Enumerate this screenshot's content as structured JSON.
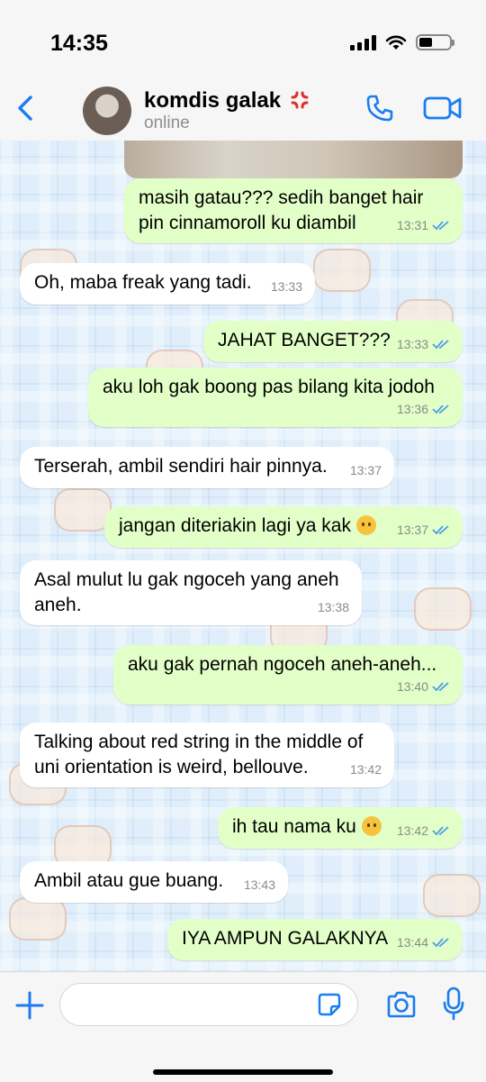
{
  "status_bar": {
    "time": "14:35"
  },
  "header": {
    "contact_name": "komdis galak",
    "contact_status": "online"
  },
  "messages": [
    {
      "direction": "out",
      "text": "masih gatau??? sedih banget hair\npin cinnamoroll ku diambil",
      "time": "13:31",
      "read": true
    },
    {
      "direction": "in",
      "text": "Oh, maba freak yang tadi.",
      "time": "13:33"
    },
    {
      "direction": "out",
      "text": "JAHAT BANGET???",
      "time": "13:33",
      "read": true
    },
    {
      "direction": "out",
      "text": "aku loh gak boong pas bilang kita jodoh",
      "time": "13:36",
      "read": true
    },
    {
      "direction": "in",
      "text": "Terserah, ambil sendiri hair pinnya.",
      "time": "13:37"
    },
    {
      "direction": "out",
      "text": "jangan diteriakin lagi ya kak",
      "emoji": "disappointed-face",
      "time": "13:37",
      "read": true
    },
    {
      "direction": "in",
      "text": "Asal mulut lu gak ngoceh yang aneh\naneh.",
      "time": "13:38"
    },
    {
      "direction": "out",
      "text": "aku gak pernah ngoceh aneh-aneh...",
      "time": "13:40",
      "read": true
    },
    {
      "direction": "in",
      "text": "Talking about red string in the middle of\nuni orientation is weird, bellouve.",
      "time": "13:42"
    },
    {
      "direction": "out",
      "text": "ih tau nama ku",
      "emoji": "shushing-face",
      "time": "13:42",
      "read": true
    },
    {
      "direction": "in",
      "text": "Ambil atau gue buang.",
      "time": "13:43"
    },
    {
      "direction": "out",
      "text": "IYA AMPUN GALAKNYA",
      "time": "13:44",
      "read": true
    }
  ],
  "input_bar": {
    "placeholder": ""
  },
  "colors": {
    "accent": "#1a7cf0",
    "outgoing_bubble": "#e2ffc8",
    "incoming_bubble": "#ffffff",
    "read_ticks": "#4f9ce8"
  },
  "icons": [
    "back-chevron-icon",
    "phone-icon",
    "video-camera-icon",
    "plus-icon",
    "sticker-icon",
    "camera-icon",
    "microphone-icon",
    "anger-symbol-icon"
  ]
}
